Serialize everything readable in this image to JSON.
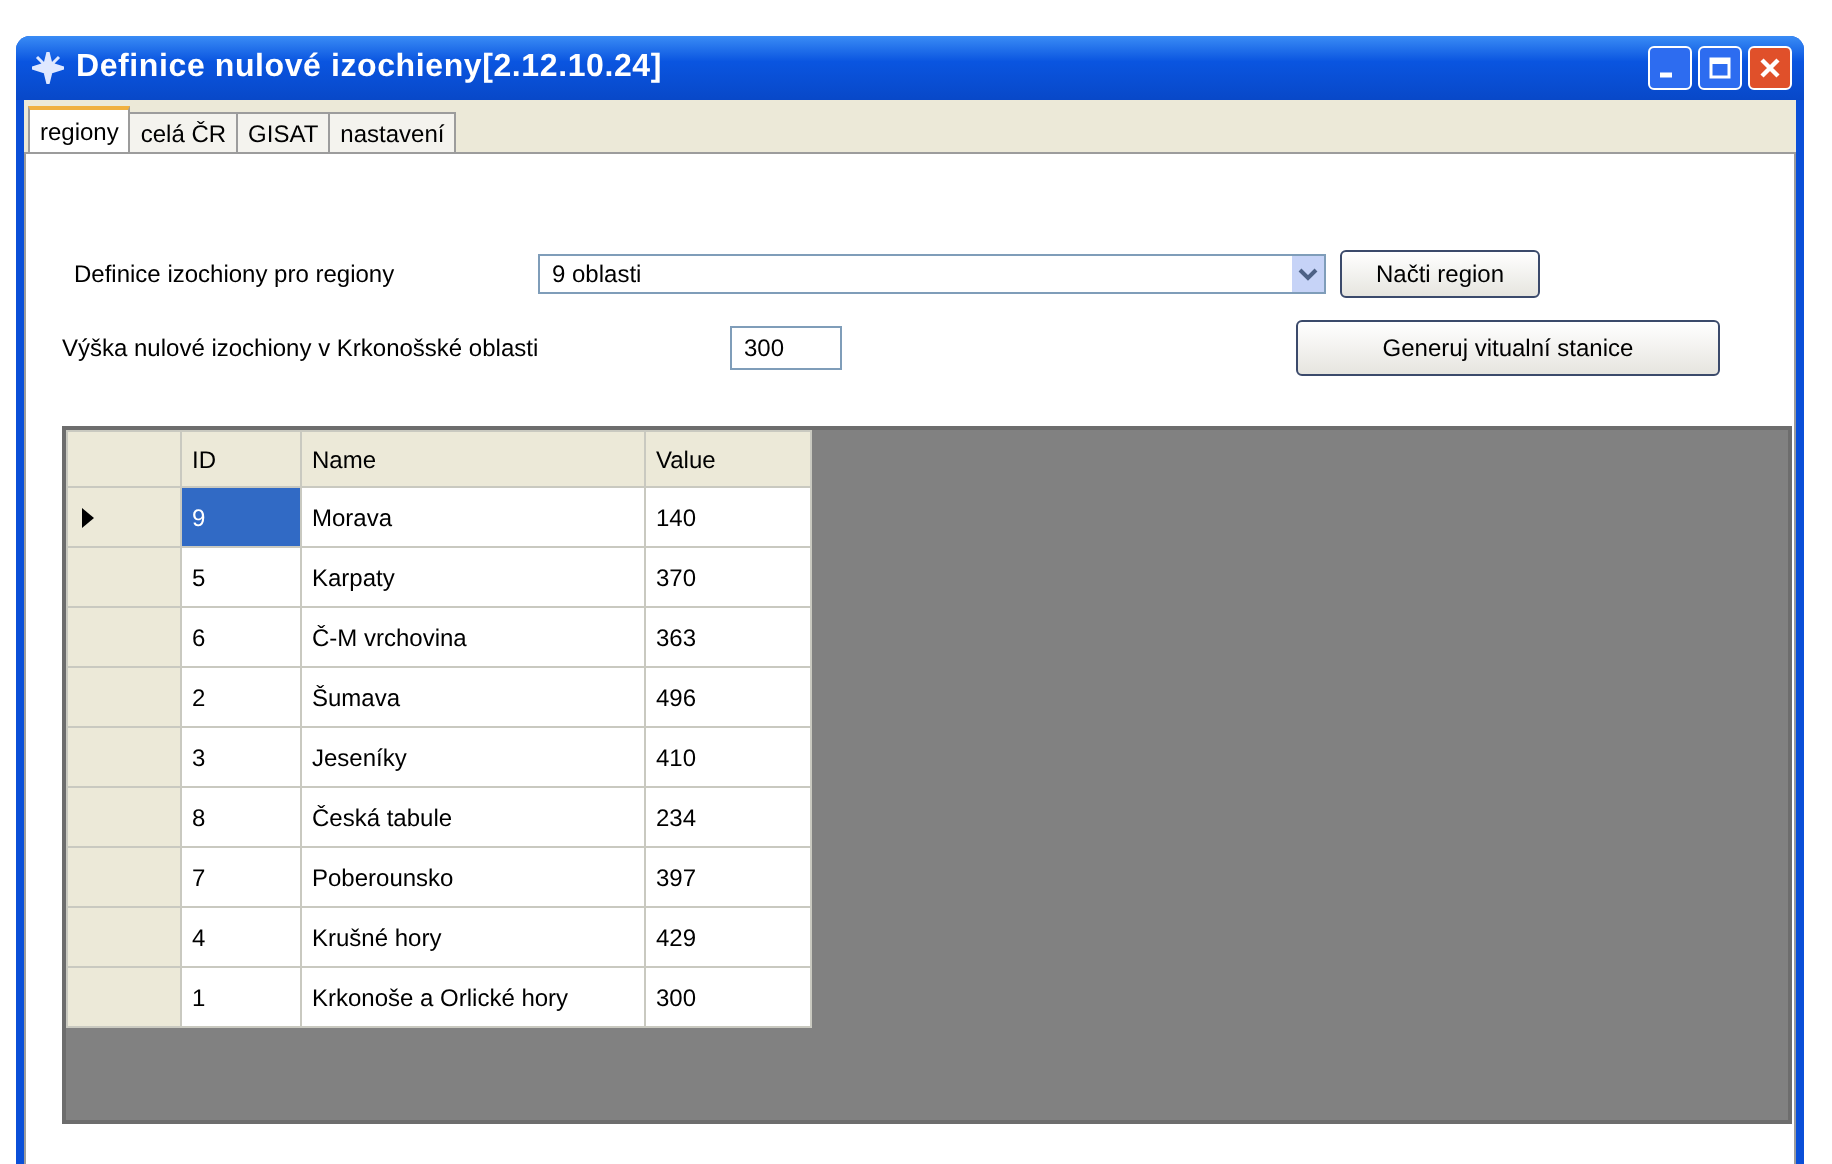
{
  "window": {
    "title": "Definice nulové izochieny[2.12.10.24]"
  },
  "tabs": [
    {
      "label": "regiony",
      "selected": true
    },
    {
      "label": "celá ČR",
      "selected": false
    },
    {
      "label": "GISAT",
      "selected": false
    },
    {
      "label": "nastavení",
      "selected": false
    }
  ],
  "region_definition": {
    "label": "Definice izochiony pro regiony",
    "value": "9 oblasti",
    "button": "Načti region"
  },
  "height": {
    "label": "Výška nulové izochiony v Krkonošské oblasti",
    "value": "300",
    "button": "Generuj vitualní stanice"
  },
  "table": {
    "columns": [
      "ID",
      "Name",
      "Value"
    ],
    "rows": [
      {
        "cells": [
          "9",
          "Morava",
          "140"
        ],
        "selected": true
      },
      {
        "cells": [
          "5",
          "Karpaty",
          "370"
        ],
        "selected": false
      },
      {
        "cells": [
          "6",
          "Č-M vrchovina",
          "363"
        ],
        "selected": false
      },
      {
        "cells": [
          "2",
          "Šumava",
          "496"
        ],
        "selected": false
      },
      {
        "cells": [
          "3",
          "Jeseníky",
          "410"
        ],
        "selected": false
      },
      {
        "cells": [
          "8",
          "Česká tabule",
          "234"
        ],
        "selected": false
      },
      {
        "cells": [
          "7",
          "Poberounsko",
          "397"
        ],
        "selected": false
      },
      {
        "cells": [
          "4",
          "Krušné hory",
          "429"
        ],
        "selected": false
      },
      {
        "cells": [
          "1",
          "Krkonoše a Orlické hory",
          "300"
        ],
        "selected": false
      }
    ]
  }
}
